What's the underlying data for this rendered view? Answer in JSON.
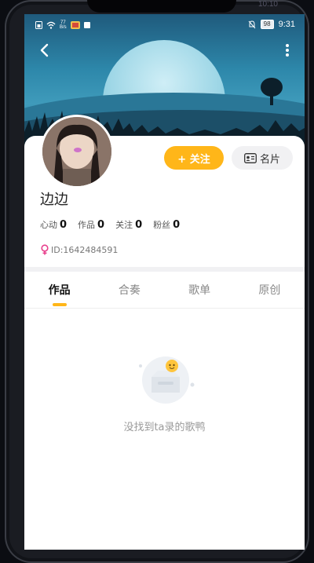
{
  "status_bar": {
    "network_left": "77",
    "network_sub": "B/s",
    "battery": "98",
    "time": "9:31"
  },
  "frame": {
    "ghost_time": "10:10"
  },
  "nav": {
    "back_icon": "chevron-left-icon",
    "more_icon": "more-vertical-icon"
  },
  "profile": {
    "name": "边边",
    "follow_label": "+ 关注",
    "card_label": "名片",
    "id_text": "ID:1642484591",
    "gender": "female",
    "stats": [
      {
        "label": "心动",
        "value": "0"
      },
      {
        "label": "作品",
        "value": "0"
      },
      {
        "label": "关注",
        "value": "0"
      },
      {
        "label": "粉丝",
        "value": "0"
      }
    ]
  },
  "tabs": [
    {
      "label": "作品",
      "active": true
    },
    {
      "label": "合奏",
      "active": false
    },
    {
      "label": "歌单",
      "active": false
    },
    {
      "label": "原创",
      "active": false
    }
  ],
  "empty_state": {
    "text": "没找到ta录的歌鸭",
    "icon": "empty-box-icon"
  },
  "colors": {
    "accent": "#ffb619",
    "gender_female": "#e8408d"
  }
}
